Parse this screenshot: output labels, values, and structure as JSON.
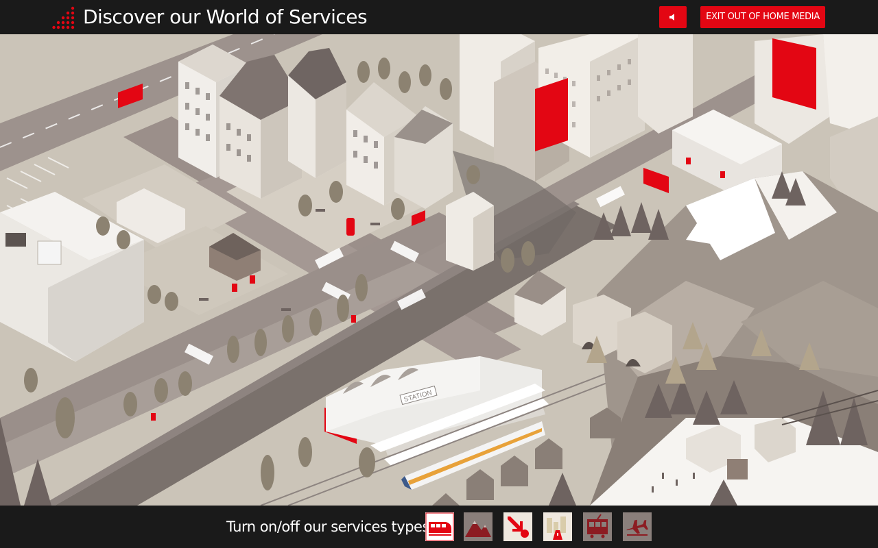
{
  "header": {
    "title": "Discover our World of Services",
    "sound_button_icon": "speaker-icon",
    "exit_button_label": "EXIT OUT OF HOME MEDIA",
    "accent_color": "#e30613"
  },
  "footer": {
    "filter_label": "Turn on/off our services types:",
    "filters": [
      {
        "icon": "train-icon",
        "active": true
      },
      {
        "icon": "mountains-icon",
        "active": false
      },
      {
        "icon": "arrow-target-icon",
        "active": true
      },
      {
        "icon": "city-road-icon",
        "active": true
      },
      {
        "icon": "tram-icon",
        "active": false
      },
      {
        "icon": "airplane-icon",
        "active": false
      }
    ]
  },
  "scene": {
    "sign_text": "STATION"
  }
}
